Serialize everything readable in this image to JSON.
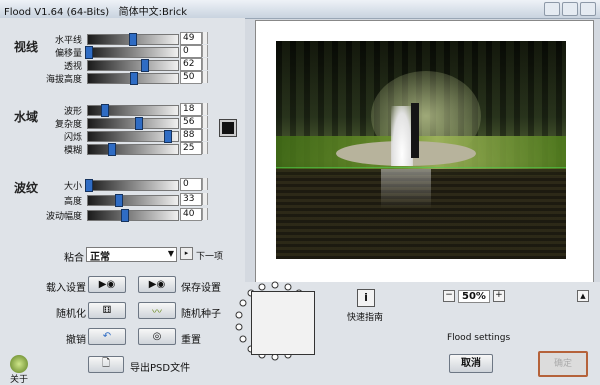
{
  "window": {
    "title": "Flood V1.64 (64-Bits)   简体中文:Brick"
  },
  "sections": {
    "view": "视线",
    "waterfield": "水域",
    "ripple": "波纹"
  },
  "params": {
    "view": [
      {
        "label": "水平线",
        "value": "49",
        "level": 0.49
      },
      {
        "label": "偏移量",
        "value": "0",
        "level": 0.0
      },
      {
        "label": "透视",
        "value": "62",
        "level": 0.62
      },
      {
        "label": "海拔高度",
        "value": "50",
        "level": 0.5
      }
    ],
    "waterfield": [
      {
        "label": "波形",
        "value": "18",
        "level": 0.18
      },
      {
        "label": "复杂度",
        "value": "56",
        "level": 0.56
      },
      {
        "label": "闪烁",
        "value": "88",
        "level": 0.88
      },
      {
        "label": "模糊",
        "value": "25",
        "level": 0.25
      }
    ],
    "ripple": [
      {
        "label": "大小",
        "value": "0",
        "level": 0.0
      },
      {
        "label": "高度",
        "value": "33",
        "level": 0.33
      },
      {
        "label": "波动幅度",
        "value": "40",
        "level": 0.4
      }
    ]
  },
  "blend": {
    "label": "粘合",
    "value": "正常",
    "next_label": "下一项"
  },
  "actions": {
    "load": "载入设置",
    "save": "保存设置",
    "randomize": "随机化",
    "random_seed": "随机种子",
    "undo": "撤销",
    "reset": "重置",
    "export": "导出PSD文件",
    "about": "关于"
  },
  "footer": {
    "quick_guide": "快速指南",
    "zoom": "50%",
    "settings_label": "Flood settings",
    "cancel": "取消",
    "ok": "确定"
  },
  "colors": {
    "water_color": "#111111",
    "slider_thumb": "#2f6cc4",
    "ok_border": "#b5623a"
  }
}
